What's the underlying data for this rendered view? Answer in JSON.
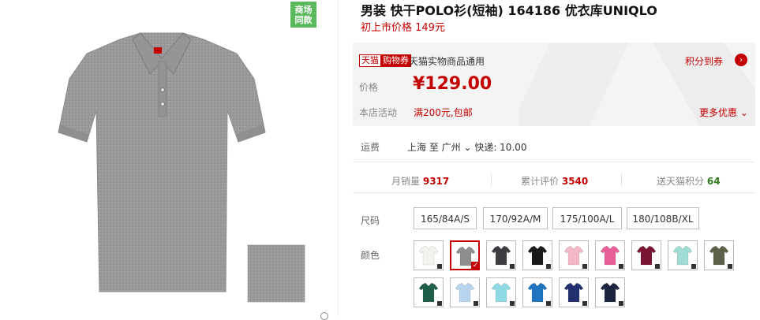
{
  "gallery": {
    "badge": "商场\n同款"
  },
  "product": {
    "title": "男装 快干POLO衫(短袖) 164186 优衣库UNIQLO",
    "original_price": "初上市价格 149元"
  },
  "promo": {
    "tmall_tag": "天猫",
    "coupon_tag": "购物券",
    "coupon_desc": "天猫实物商品通用",
    "points_link": "积分到券",
    "price_label": "价格",
    "price_value": "¥129.00",
    "activity_label": "本店活动",
    "activity_value": "满200元,包邮",
    "more_deals": "更多优惠"
  },
  "shipping": {
    "label": "运费",
    "value": "上海 至 广州 ⌄ 快递: 10.00"
  },
  "stats": {
    "monthly_sales_label": "月销量",
    "monthly_sales_value": "9317",
    "reviews_label": "累计评价",
    "reviews_value": "3540",
    "points_label": "送天猫积分",
    "points_value": "64"
  },
  "sizes": {
    "label": "尺码",
    "options": [
      "165/84A/S",
      "170/92A/M",
      "175/100A/L",
      "180/108B/XL"
    ]
  },
  "colors": {
    "label": "颜色",
    "swatches": [
      {
        "name": "white",
        "color": "#f2f2ef"
      },
      {
        "name": "gray",
        "color": "#8e8e8e",
        "selected": true
      },
      {
        "name": "charcoal",
        "color": "#3b3d40"
      },
      {
        "name": "black",
        "color": "#1a1a1a"
      },
      {
        "name": "light-pink",
        "color": "#f2b8c8"
      },
      {
        "name": "pink",
        "color": "#e85f97"
      },
      {
        "name": "wine",
        "color": "#7a1634"
      },
      {
        "name": "mint",
        "color": "#9fdcd4"
      },
      {
        "name": "olive",
        "color": "#5c6149"
      },
      {
        "name": "dark-green",
        "color": "#1f5e48"
      },
      {
        "name": "light-blue",
        "color": "#b7d3ee"
      },
      {
        "name": "aqua",
        "color": "#8ed9e4"
      },
      {
        "name": "blue",
        "color": "#1f74c0"
      },
      {
        "name": "navy-blue",
        "color": "#22306f"
      },
      {
        "name": "navy",
        "color": "#1c2540"
      }
    ]
  }
}
